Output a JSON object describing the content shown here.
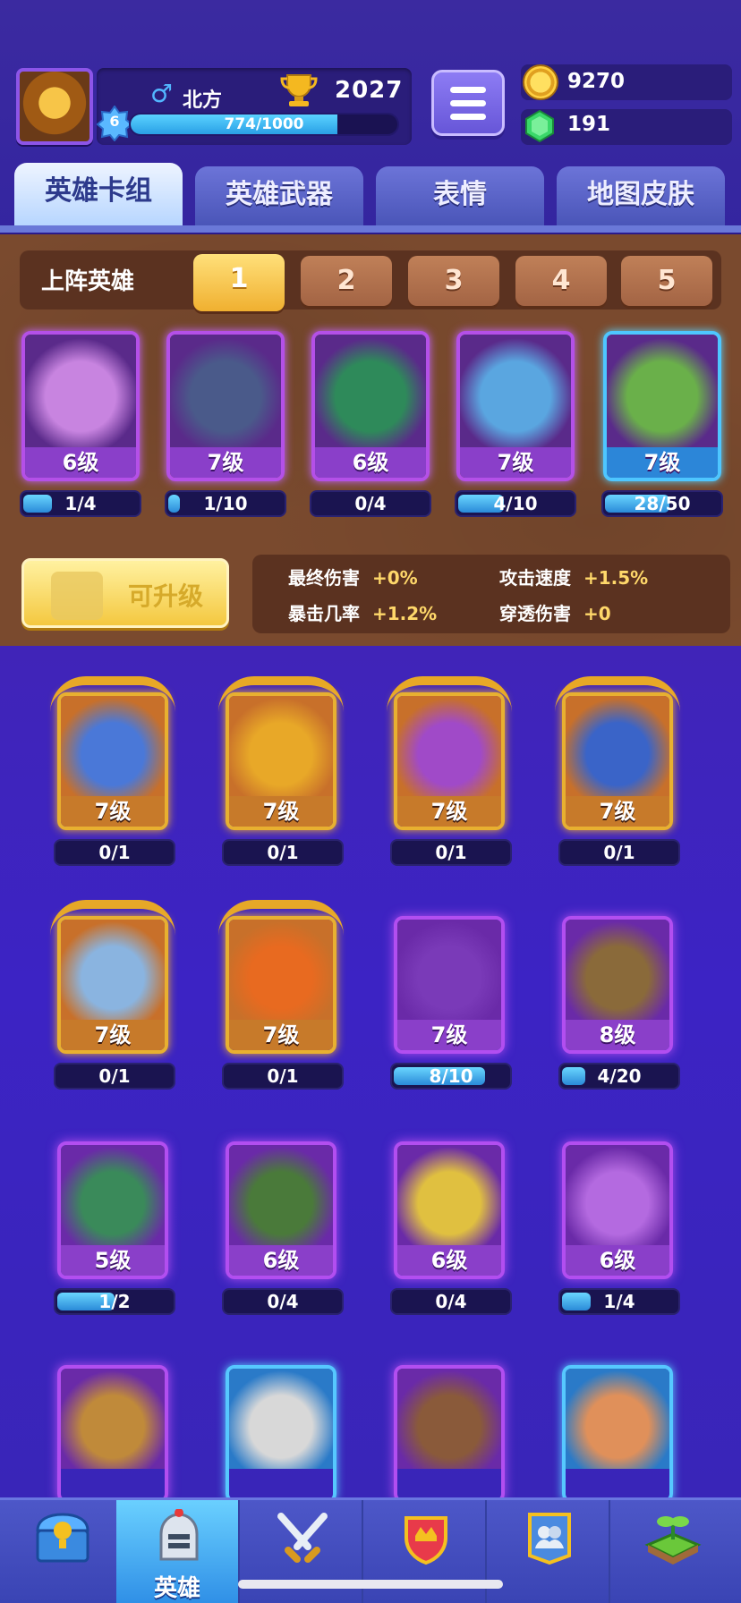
{
  "player": {
    "name": "北方",
    "gender_icon": "male-symbol-icon",
    "trophies": "2027",
    "level": "6",
    "xp": "774/1000",
    "xp_fraction": 0.774
  },
  "resources": {
    "coins": "9270",
    "gems": "191"
  },
  "tabs": [
    {
      "label": "英雄卡组",
      "active": true
    },
    {
      "label": "英雄武器",
      "active": false
    },
    {
      "label": "表情",
      "active": false
    },
    {
      "label": "地图皮肤",
      "active": false
    }
  ],
  "lineup": {
    "label": "上阵英雄",
    "slots": [
      "1",
      "2",
      "3",
      "4",
      "5"
    ],
    "active_slot": "1"
  },
  "deck": [
    {
      "level": "6级",
      "progress": "1/4",
      "fraction": 0.25,
      "rarity": "purple",
      "color": "#c884e0"
    },
    {
      "level": "7级",
      "progress": "1/10",
      "fraction": 0.1,
      "rarity": "purple",
      "color": "#4a5a8a"
    },
    {
      "level": "6级",
      "progress": "0/4",
      "fraction": 0,
      "rarity": "purple",
      "color": "#2e8a5a"
    },
    {
      "level": "7级",
      "progress": "4/10",
      "fraction": 0.4,
      "rarity": "purple",
      "color": "#5aa6e0"
    },
    {
      "level": "7级",
      "progress": "28/50",
      "fraction": 0.56,
      "rarity": "blue",
      "color": "#6ab04a"
    }
  ],
  "upgrade_button": "可升级",
  "stats": [
    {
      "label": "最终伤害",
      "value": "+0%"
    },
    {
      "label": "攻击速度",
      "value": "+1.5%"
    },
    {
      "label": "暴击几率",
      "value": "+1.2%"
    },
    {
      "label": "穿透伤害",
      "value": "+0"
    }
  ],
  "heroes": [
    {
      "level": "7级",
      "progress": "0/1",
      "fraction": 0,
      "rarity": "gold",
      "color": "#4a78d8"
    },
    {
      "level": "7级",
      "progress": "0/1",
      "fraction": 0,
      "rarity": "gold",
      "color": "#e8a828"
    },
    {
      "level": "7级",
      "progress": "0/1",
      "fraction": 0,
      "rarity": "gold",
      "color": "#a04ac8"
    },
    {
      "level": "7级",
      "progress": "0/1",
      "fraction": 0,
      "rarity": "gold",
      "color": "#3a64c8"
    },
    {
      "level": "7级",
      "progress": "0/1",
      "fraction": 0,
      "rarity": "gold",
      "color": "#8ab4e0"
    },
    {
      "level": "7级",
      "progress": "0/1",
      "fraction": 0,
      "rarity": "gold",
      "color": "#e86a20"
    },
    {
      "level": "7级",
      "progress": "8/10",
      "fraction": 0.8,
      "rarity": "purple",
      "color": "#7a3ab8"
    },
    {
      "level": "8级",
      "progress": "4/20",
      "fraction": 0.2,
      "rarity": "purple",
      "color": "#8a6a3a"
    },
    {
      "level": "5级",
      "progress": "1/2",
      "fraction": 0.5,
      "rarity": "purple",
      "color": "#3a8a5a"
    },
    {
      "level": "6级",
      "progress": "0/4",
      "fraction": 0,
      "rarity": "purple",
      "color": "#4a7a3a"
    },
    {
      "level": "6级",
      "progress": "0/4",
      "fraction": 0,
      "rarity": "purple",
      "color": "#e0c040"
    },
    {
      "level": "6级",
      "progress": "1/4",
      "fraction": 0.25,
      "rarity": "purple",
      "color": "#b46ae0"
    },
    {
      "level": "",
      "progress": "",
      "fraction": 0,
      "rarity": "purple",
      "color": "#c08a3a"
    },
    {
      "level": "",
      "progress": "",
      "fraction": 0,
      "rarity": "blue",
      "color": "#d8d8d8"
    },
    {
      "level": "",
      "progress": "",
      "fraction": 0,
      "rarity": "purple",
      "color": "#8a5a3a"
    },
    {
      "level": "",
      "progress": "",
      "fraction": 0,
      "rarity": "blue",
      "color": "#e0905a"
    }
  ],
  "nav": [
    {
      "icon": "treasure-chest-icon",
      "label": "",
      "active": false
    },
    {
      "icon": "knight-helmet-icon",
      "label": "英雄",
      "active": true
    },
    {
      "icon": "crossed-swords-icon",
      "label": "",
      "active": false
    },
    {
      "icon": "crown-shield-icon",
      "label": "",
      "active": false
    },
    {
      "icon": "friends-banner-icon",
      "label": "",
      "active": false
    },
    {
      "icon": "sprout-island-icon",
      "label": "",
      "active": false
    }
  ],
  "colors": {
    "background": "#3c23c4",
    "wood": "#7a4a2e",
    "gold": "#f0b030",
    "accent_blue": "#5ad2ff"
  }
}
